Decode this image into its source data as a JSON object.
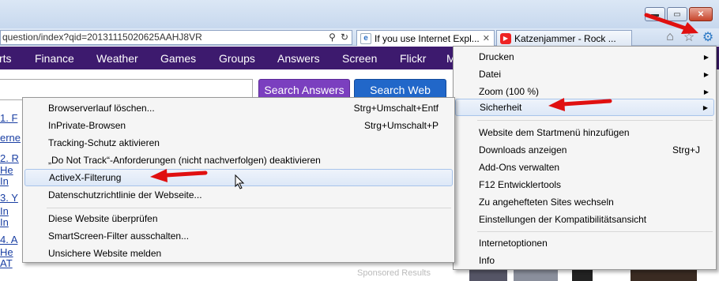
{
  "window": {
    "minimize_icon": "minimize-icon",
    "maximize_icon": "maximize-icon",
    "close_icon": "close-icon",
    "minimize_glyph": "▬",
    "maximize_glyph": "▭",
    "close_glyph": "✕"
  },
  "address_bar": {
    "url": "question/index?qid=20131115020625AAHJ8VR",
    "search_glyph": "⚲",
    "refresh_glyph": "↻"
  },
  "tabs": [
    {
      "title": "If you use Internet Expl...",
      "icon": "ie-icon",
      "glyph": "e"
    },
    {
      "title": "Katzenjammer - Rock ...",
      "icon": "youtube-icon",
      "glyph": "▶"
    }
  ],
  "tab_close_glyph": "✕",
  "nav_icons": {
    "home": "⌂",
    "favorites": "☆",
    "tools": "⚙"
  },
  "site_nav": [
    "rts",
    "Finance",
    "Weather",
    "Games",
    "Groups",
    "Answers",
    "Screen",
    "Flickr",
    "Mo"
  ],
  "search": {
    "answers_label": "Search Answers",
    "web_label": "Search Web"
  },
  "result_fragments": [
    "1. F",
    "erne",
    "2. R",
    "He",
    "In",
    "3. Y",
    "In",
    "In",
    "4. A",
    "He",
    "AT"
  ],
  "sponsored_label": "Sponsored Results",
  "tools_menu": {
    "items": [
      {
        "label": "Drucken",
        "submenu": true
      },
      {
        "label": "Datei",
        "submenu": true
      },
      {
        "label": "Zoom (100 %)",
        "submenu": true
      },
      {
        "label": "Sicherheit",
        "submenu": true,
        "highlighted": true
      },
      {
        "label": "Website dem Startmenü hinzufügen"
      },
      {
        "label": "Downloads anzeigen",
        "shortcut": "Strg+J"
      },
      {
        "label": "Add-Ons verwalten"
      },
      {
        "label": "F12 Entwicklertools"
      },
      {
        "label": "Zu angehefteten Sites wechseln"
      },
      {
        "label": "Einstellungen der Kompatibilitätsansicht"
      },
      {
        "label": "Internetoptionen"
      },
      {
        "label": "Info"
      }
    ]
  },
  "security_submenu": {
    "items": [
      {
        "label": "Browserverlauf löschen...",
        "shortcut": "Strg+Umschalt+Entf"
      },
      {
        "label": "InPrivate-Browsen",
        "shortcut": "Strg+Umschalt+P"
      },
      {
        "label": "Tracking-Schutz aktivieren"
      },
      {
        "label": "„Do Not Track“-Anforderungen (nicht nachverfolgen) deaktivieren"
      },
      {
        "label": "ActiveX-Filterung",
        "highlighted": true
      },
      {
        "label": "Datenschutzrichtlinie der Webseite..."
      },
      {
        "label": "Diese Website überprüfen"
      },
      {
        "label": "SmartScreen-Filter ausschalten..."
      },
      {
        "label": "Unsichere Website melden"
      }
    ]
  },
  "submenu_arrow_glyph": "▶",
  "annotation_color": "#e01010"
}
